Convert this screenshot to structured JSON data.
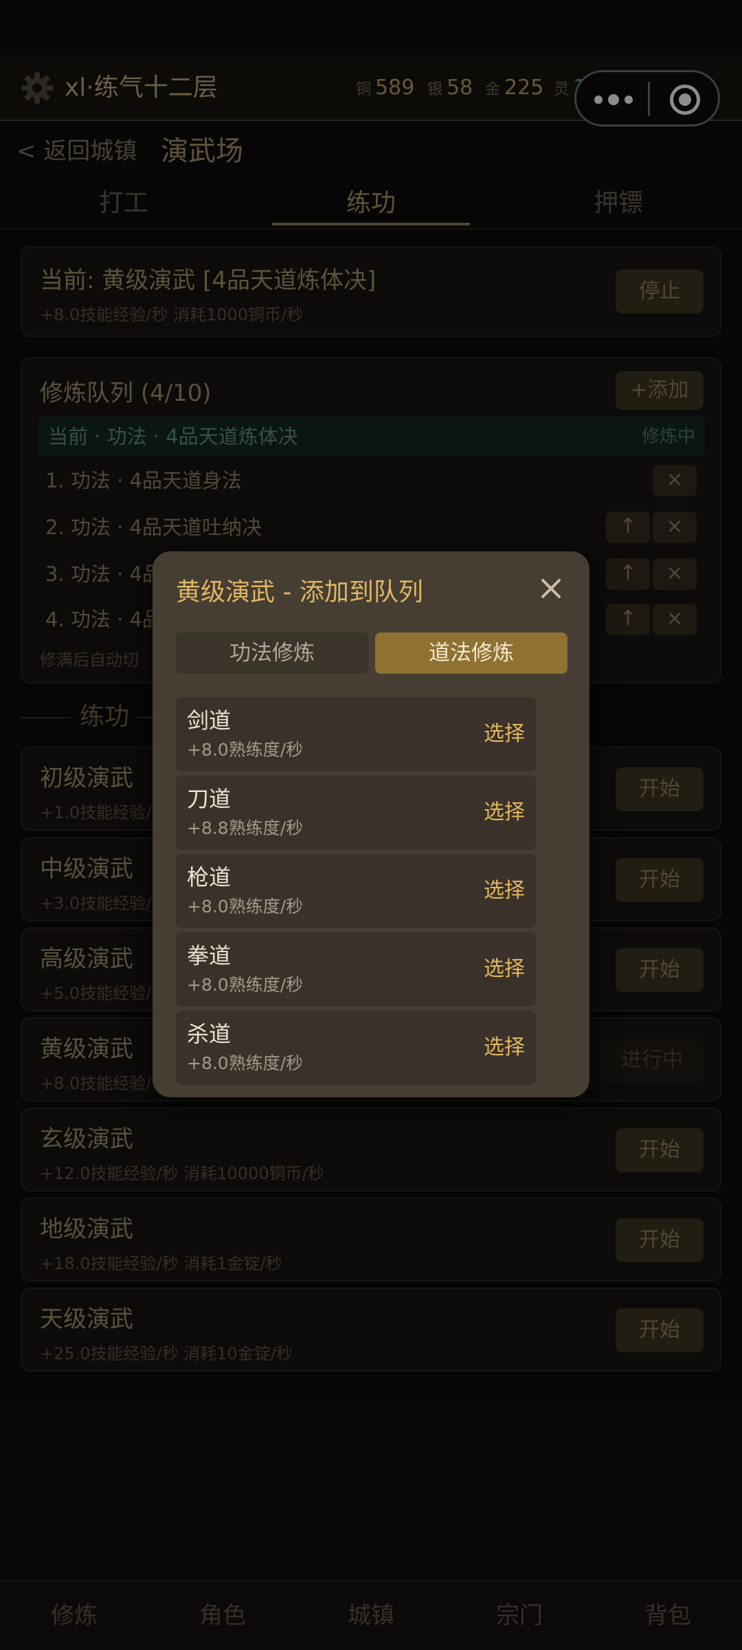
{
  "header": {
    "player_name": "xl·练气十二层",
    "currencies": [
      {
        "label": "铜",
        "value": "589"
      },
      {
        "label": "银",
        "value": "58"
      },
      {
        "label": "金",
        "value": "225"
      },
      {
        "label": "灵",
        "value": "174"
      }
    ]
  },
  "nav": {
    "back_label": "< 返回城镇",
    "page_title": "演武场"
  },
  "tabs": [
    "打工",
    "练功",
    "押镖"
  ],
  "current": {
    "title": "当前: 黄级演武 [4品天道炼体决]",
    "sub": "+8.0技能经验/秒  消耗1000铜币/秒",
    "stop_label": "停止"
  },
  "queue": {
    "title": "修炼队列 (4/10)",
    "add_label": "+添加",
    "current_item": "当前 · 功法 · 4品天道炼体决",
    "current_status": "修炼中",
    "items": [
      "1. 功法 · 4品天道身法",
      "2. 功法 · 4品天道吐纳决",
      "3. 功法 · 4品",
      "4. 功法 · 4品"
    ],
    "footer": "修满后自动切",
    "up_glyph": "↑",
    "remove_glyph": "×"
  },
  "section_title": "练功",
  "trainings": [
    {
      "name": "初级演武",
      "sub": "+1.0技能经验/",
      "action": "开始"
    },
    {
      "name": "中级演武",
      "sub": "+3.0技能经验/",
      "action": "开始"
    },
    {
      "name": "高级演武",
      "sub": "+5.0技能经验/",
      "action": "开始"
    },
    {
      "name": "黄级演武",
      "sub": "+8.0技能经验/",
      "action": "进行中"
    },
    {
      "name": "玄级演武",
      "sub": "+12.0技能经验/秒  消耗10000铜币/秒",
      "action": "开始"
    },
    {
      "name": "地级演武",
      "sub": "+18.0技能经验/秒  消耗1金锭/秒",
      "action": "开始"
    },
    {
      "name": "天级演武",
      "sub": "+25.0技能经验/秒  消耗10金锭/秒",
      "action": "开始"
    }
  ],
  "bottom_nav": [
    "修炼",
    "角色",
    "城镇",
    "宗门",
    "背包"
  ],
  "modal": {
    "title": "黄级演武 - 添加到队列",
    "tab_skill": "功法修炼",
    "tab_dao": "道法修炼",
    "select_label": "选择",
    "items": [
      {
        "name": "剑道",
        "rate": "+8.0熟练度/秒"
      },
      {
        "name": "刀道",
        "rate": "+8.8熟练度/秒"
      },
      {
        "name": "枪道",
        "rate": "+8.0熟练度/秒"
      },
      {
        "name": "拳道",
        "rate": "+8.0熟练度/秒"
      },
      {
        "name": "杀道",
        "rate": "+8.0熟练度/秒"
      }
    ]
  },
  "colors": {
    "accent_gold": "#e0b760",
    "active_segment": "#8f7131",
    "modal_bg": "#463d33",
    "queue_active_bg": "#13261d",
    "spirit_blue": "#4e8fb0"
  }
}
